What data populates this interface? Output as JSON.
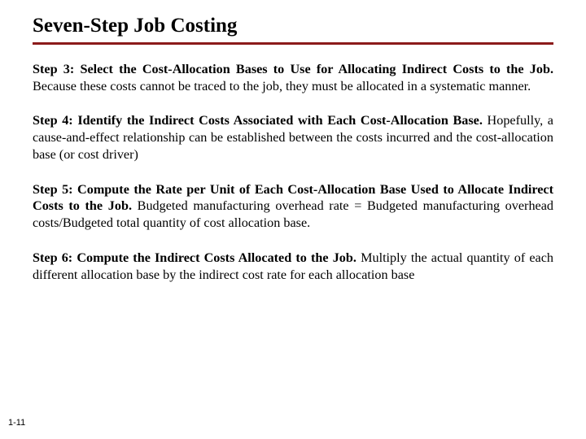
{
  "title": "Seven-Step Job Costing",
  "steps": [
    {
      "lead": "Step 3: Select the Cost-Allocation Bases to Use for Allocating Indirect Costs to the Job. ",
      "rest": "Because these costs cannot be traced to the job, they must be allocated in a systematic manner."
    },
    {
      "lead": "Step 4: Identify the Indirect Costs Associated with Each Cost-Allocation Base. ",
      "rest": "Hopefully, a cause-and-effect relationship can be established between the costs incurred and the cost-allocation base (or cost driver)"
    },
    {
      "lead": "Step 5: Compute the Rate per Unit of Each Cost-Allocation Base Used to Allocate Indirect Costs to the Job. ",
      "rest": "Budgeted manufacturing overhead rate = Budgeted manufacturing overhead costs/Budgeted total quantity of cost allocation base."
    },
    {
      "lead": "Step 6: Compute the Indirect Costs Allocated to the Job. ",
      "rest": "Multiply the actual quantity of each different allocation base by the indirect cost rate for each allocation base"
    }
  ],
  "pagenum": "1-11"
}
